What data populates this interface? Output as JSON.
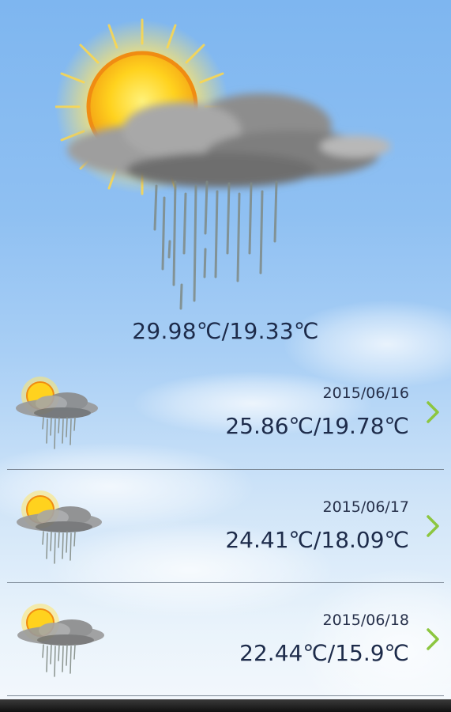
{
  "current": {
    "icon": "sun-cloud-rain-icon",
    "temperature": "29.98℃/19.33℃"
  },
  "forecast": [
    {
      "date": "2015/06/16",
      "temperature": "25.86℃/19.78℃",
      "icon": "sun-cloud-rain-icon"
    },
    {
      "date": "2015/06/17",
      "temperature": "24.41℃/18.09℃",
      "icon": "sun-cloud-rain-icon"
    },
    {
      "date": "2015/06/18",
      "temperature": "22.44℃/15.9℃",
      "icon": "sun-cloud-rain-icon"
    }
  ],
  "colors": {
    "text": "#1d2b4a",
    "chevron": "#8cc63f",
    "sky_top": "#7eb6f0"
  }
}
